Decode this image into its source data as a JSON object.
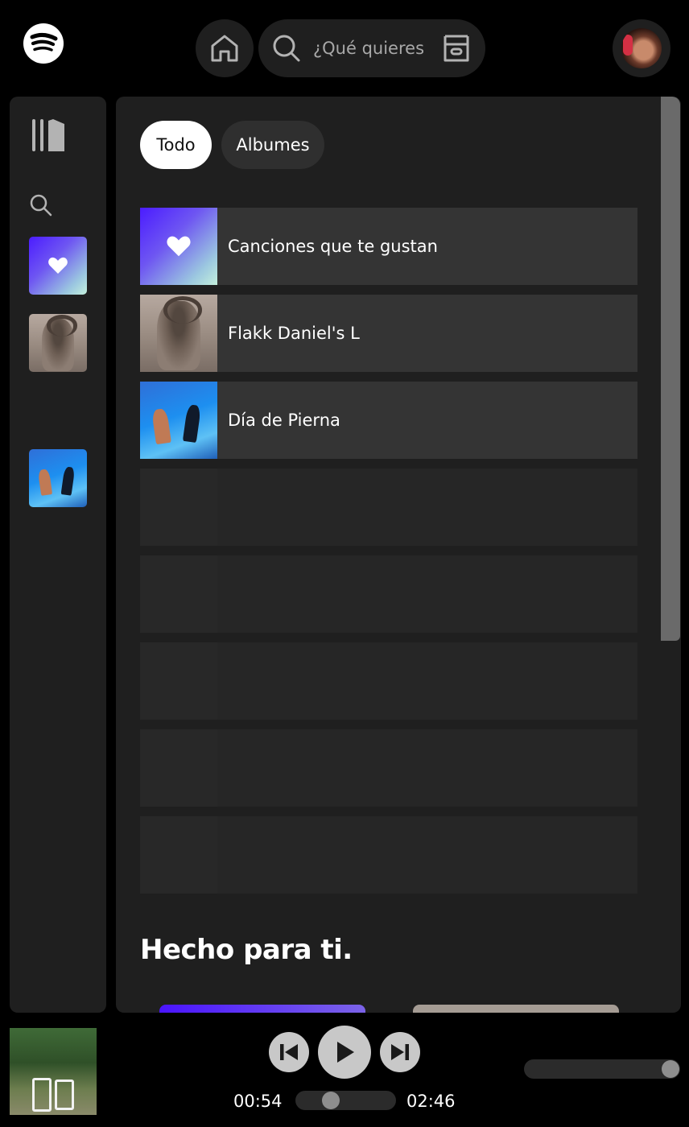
{
  "app": {
    "logo_icon": "spotify-logo-icon",
    "home_icon": "home-icon",
    "search_icon": "search-icon",
    "browse_icon": "browse-icon",
    "avatar_icon": "user-avatar"
  },
  "search": {
    "placeholder": "¿Qué quieres",
    "value": ""
  },
  "sidebar": {
    "library_icon": "library-icon",
    "search_icon": "search-icon",
    "items": [
      {
        "name": "Canciones que te gustan",
        "icon": "heart-icon"
      },
      {
        "name": "Flakk Daniel's L",
        "icon": "album-cover"
      },
      {
        "name": "Día de Pierna",
        "icon": "album-cover"
      }
    ]
  },
  "filters": {
    "all_label": "Todo",
    "albums_label": "Albumes",
    "selected": "Todo"
  },
  "library": {
    "rows": [
      {
        "title": "Canciones que te gustan"
      },
      {
        "title": "Flakk Daniel's L"
      },
      {
        "title": "Día de Pierna"
      }
    ],
    "placeholder_row_count": 5
  },
  "sections": {
    "made_for_you_title": "Hecho para ti."
  },
  "player": {
    "current_time": "00:54",
    "duration": "02:46",
    "progress": 0.325,
    "volume": 1.0,
    "prev_icon": "skip-previous-icon",
    "play_icon": "play-icon",
    "next_icon": "skip-next-icon"
  },
  "colors": {
    "background": "#000000",
    "panel": "#1f1f1f",
    "row": "#343434",
    "accent_gradient_start": "#4b1cff",
    "accent_gradient_end": "#c4f0dc"
  }
}
